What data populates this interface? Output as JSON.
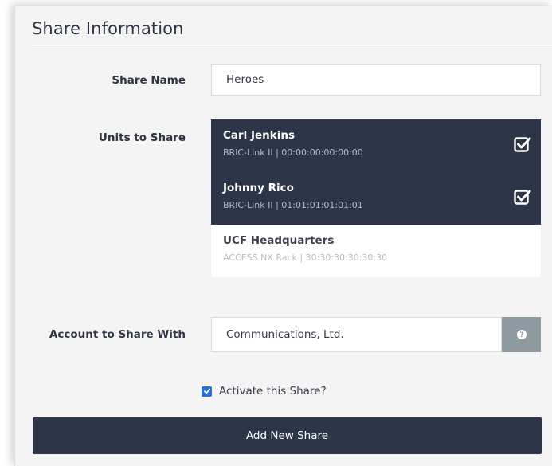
{
  "form": {
    "title": "Share Information",
    "share_name": {
      "label": "Share Name",
      "value": "Heroes"
    },
    "units": {
      "label": "Units to Share",
      "items": [
        {
          "name": "Carl Jenkins",
          "detail": "BRIC-Link II | 00:00:00:00:00:00",
          "selected": true
        },
        {
          "name": "Johnny Rico",
          "detail": "BRIC-Link II | 01:01:01:01:01:01",
          "selected": true
        },
        {
          "name": "UCF Headquarters",
          "detail": "ACCESS NX Rack | 30:30:30:30:30:30",
          "selected": false
        }
      ]
    },
    "account": {
      "label": "Account to Share With",
      "value": "Communications, Ltd.",
      "help_icon": "question-circle-icon"
    },
    "activate": {
      "label": "Activate this Share?",
      "checked": true
    },
    "submit_label": "Add New Share"
  },
  "colors": {
    "selected_bg": "#2c3648",
    "help_button": "#8d9aa0",
    "checkbox": "#2a6fd8"
  }
}
